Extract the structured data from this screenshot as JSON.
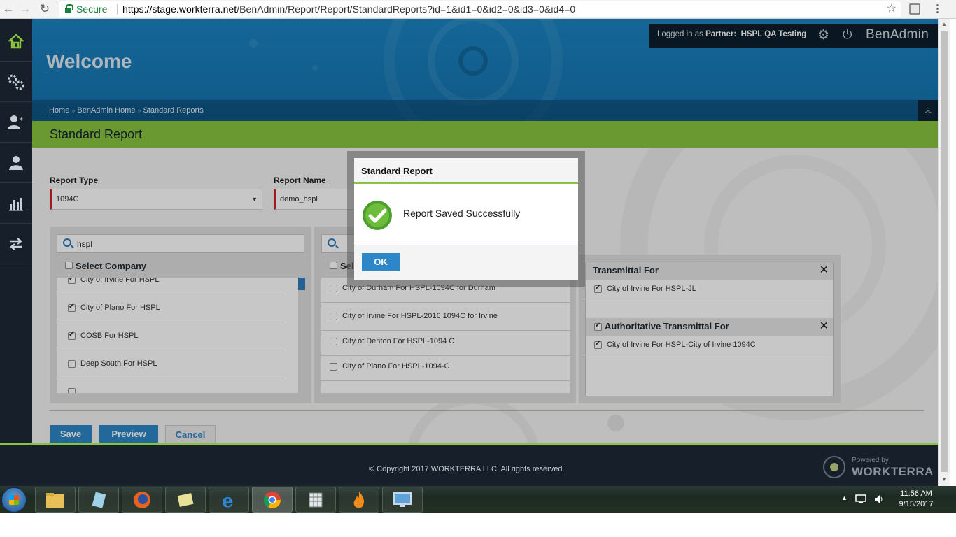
{
  "browser": {
    "secure_label": "Secure",
    "url_host": "https://stage.workterra.net",
    "url_path": "/BenAdmin/Report/Report/StandardReports?id=1&id1=0&id2=0&id3=0&id4=0"
  },
  "header": {
    "welcome": "Welcome",
    "logged_in_prefix": "Logged in as",
    "logged_in_role": "Partner:",
    "logged_in_user": "HSPL QA Testing",
    "brand": "BenAdmin",
    "breadcrumb": [
      "Home",
      "BenAdmin Home",
      "Standard Reports"
    ]
  },
  "page": {
    "title": "Standard Report",
    "report_type_label": "Report Type",
    "report_type_value": "1094C",
    "report_name_label": "Report Name",
    "report_name_value": "demo_hspl",
    "company_search_value": "hspl",
    "select_company_label": "Select Company",
    "select_second_label": "Sel",
    "companies": [
      {
        "name": "City of Irvine For HSPL",
        "checked": true
      },
      {
        "name": "City of Plano For HSPL",
        "checked": true
      },
      {
        "name": "COSB For HSPL",
        "checked": true
      },
      {
        "name": "Deep South For HSPL",
        "checked": false
      }
    ],
    "second_list": [
      {
        "name": "City of Durham For HSPL-1094C for Durham",
        "checked": false
      },
      {
        "name": "City of Irvine For HSPL-2016 1094C for Irvine",
        "checked": false
      },
      {
        "name": "City of Denton For HSPL-1094 C",
        "checked": false
      },
      {
        "name": "City of Plano For HSPL-1094-C",
        "checked": false
      }
    ],
    "transmittal_for_label": "Transmittal For",
    "transmittal_items": [
      "City of Irvine For HSPL-JL"
    ],
    "auth_transmittal_label": "Authoritative Transmittal For",
    "auth_transmittal_items": [
      "City of Irvine For HSPL-City of Irvine 1094C"
    ],
    "buttons": {
      "save": "Save",
      "preview": "Preview",
      "cancel": "Cancel"
    }
  },
  "modal": {
    "title": "Standard Report",
    "message": "Report Saved Successfully",
    "ok_label": "OK"
  },
  "footer": {
    "copyright": "© Copyright 2017 WORKTERRA LLC. All rights reserved.",
    "powered_by": "Powered by",
    "powered_brand": "WORKTERRA"
  },
  "taskbar": {
    "time": "11:56 AM",
    "date": "9/15/2017"
  },
  "colors": {
    "accent_green": "#8ac43f",
    "primary_blue": "#2c86c7",
    "banner_blue": "#1a84c3",
    "sidebar_dark": "#17202a"
  }
}
